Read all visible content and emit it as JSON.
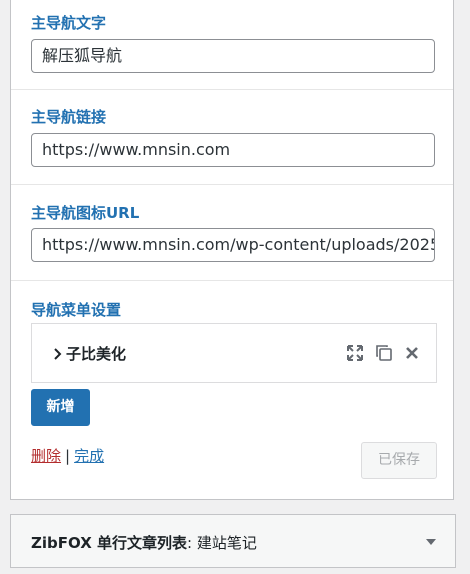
{
  "fields": {
    "nav_text": {
      "label": "主导航文字",
      "value": "解压狐导航"
    },
    "nav_link": {
      "label": "主导航链接",
      "value": "https://www.mnsin.com"
    },
    "nav_icon_url": {
      "label": "主导航图标URL",
      "value": "https://www.mnsin.com/wp-content/uploads/2025"
    }
  },
  "menu_settings": {
    "label": "导航菜单设置",
    "items": [
      {
        "title": "子比美化"
      }
    ],
    "add_button": "新增"
  },
  "footer_actions": {
    "delete": "删除",
    "separator": "|",
    "done": "完成",
    "saved_button": "已保存"
  },
  "next_widget": {
    "title_bold": "ZibFOX 单行文章列表",
    "title_rest": ": 建站笔记"
  },
  "colors": {
    "accent": "#2271b1",
    "delete": "#b32d2e",
    "border": "#c3c4c7"
  }
}
